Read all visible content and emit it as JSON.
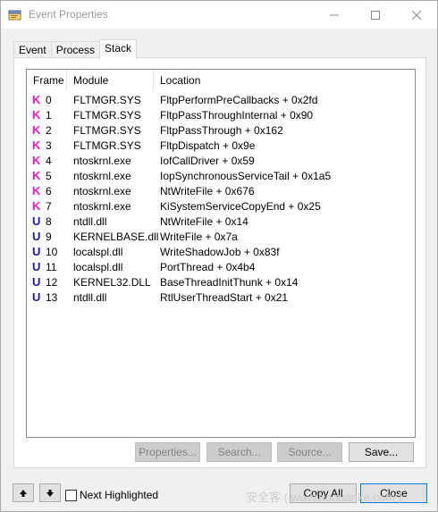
{
  "window": {
    "title": "Event Properties"
  },
  "tabs": [
    {
      "label": "Event"
    },
    {
      "label": "Process"
    },
    {
      "label": "Stack"
    }
  ],
  "stack": {
    "columns": [
      "Frame",
      "Module",
      "Location"
    ],
    "rows": [
      {
        "mode": "K",
        "frame": "0",
        "module": "FLTMGR.SYS",
        "location": "FltpPerformPreCallbacks + 0x2fd"
      },
      {
        "mode": "K",
        "frame": "1",
        "module": "FLTMGR.SYS",
        "location": "FltpPassThroughInternal + 0x90"
      },
      {
        "mode": "K",
        "frame": "2",
        "module": "FLTMGR.SYS",
        "location": "FltpPassThrough + 0x162"
      },
      {
        "mode": "K",
        "frame": "3",
        "module": "FLTMGR.SYS",
        "location": "FltpDispatch + 0x9e"
      },
      {
        "mode": "K",
        "frame": "4",
        "module": "ntoskrnl.exe",
        "location": "IofCallDriver + 0x59"
      },
      {
        "mode": "K",
        "frame": "5",
        "module": "ntoskrnl.exe",
        "location": "IopSynchronousServiceTail + 0x1a5"
      },
      {
        "mode": "K",
        "frame": "6",
        "module": "ntoskrnl.exe",
        "location": "NtWriteFile + 0x676"
      },
      {
        "mode": "K",
        "frame": "7",
        "module": "ntoskrnl.exe",
        "location": "KiSystemServiceCopyEnd + 0x25"
      },
      {
        "mode": "U",
        "frame": "8",
        "module": "ntdll.dll",
        "location": "NtWriteFile + 0x14"
      },
      {
        "mode": "U",
        "frame": "9",
        "module": "KERNELBASE.dll",
        "location": "WriteFile + 0x7a"
      },
      {
        "mode": "U",
        "frame": "10",
        "module": "localspl.dll",
        "location": "WriteShadowJob + 0x83f"
      },
      {
        "mode": "U",
        "frame": "11",
        "module": "localspl.dll",
        "location": "PortThread + 0x4b4"
      },
      {
        "mode": "U",
        "frame": "12",
        "module": "KERNEL32.DLL",
        "location": "BaseThreadInitThunk + 0x14"
      },
      {
        "mode": "U",
        "frame": "13",
        "module": "ntdll.dll",
        "location": "RtlUserThreadStart + 0x21"
      }
    ]
  },
  "buttons": {
    "properties": "Properties...",
    "search": "Search...",
    "source": "Source...",
    "save": "Save...",
    "copy_all": "Copy All",
    "close": "Close"
  },
  "footer": {
    "next_highlighted": "Next Highlighted"
  },
  "watermark": "安全客 ( www.anquanke.com )",
  "colors": {
    "kernel_mode": "#e81bbf",
    "user_mode": "#1a1aa6"
  },
  "icons": {
    "app": "event-properties-icon",
    "minimize": "minimize-icon",
    "maximize": "maximize-icon",
    "close": "close-icon",
    "up": "arrow-up-icon",
    "down": "arrow-down-icon"
  }
}
